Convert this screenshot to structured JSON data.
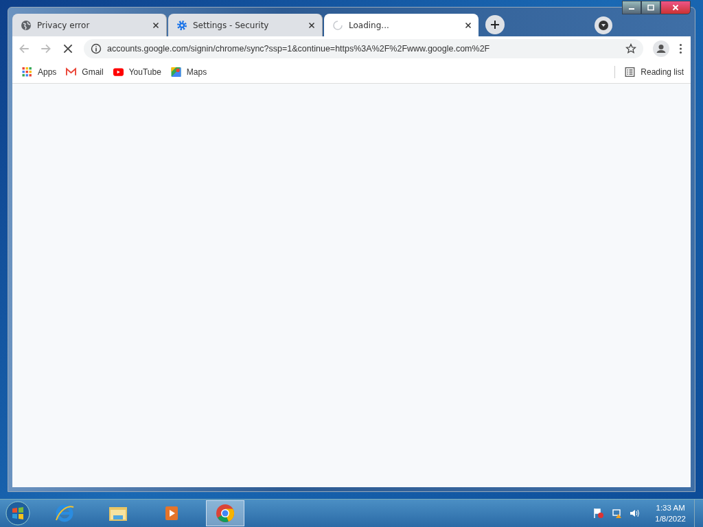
{
  "tabs": [
    {
      "kind": "globe",
      "title": "Privacy error",
      "selected": false
    },
    {
      "kind": "gear",
      "title": "Settings - Security",
      "selected": false
    },
    {
      "kind": "spinner",
      "title": "Loading...",
      "selected": true
    }
  ],
  "address": {
    "value": "accounts.google.com/signin/chrome/sync?ssp=1&continue=https%3A%2F%2Fwww.google.com%2F"
  },
  "bookmarks": [
    {
      "kind": "apps",
      "label": "Apps"
    },
    {
      "kind": "gmail",
      "label": "Gmail"
    },
    {
      "kind": "youtube",
      "label": "YouTube"
    },
    {
      "kind": "maps",
      "label": "Maps"
    }
  ],
  "reading_list": {
    "label": "Reading list"
  },
  "taskbar": {
    "items": [
      {
        "kind": "ie",
        "selected": false
      },
      {
        "kind": "explorer",
        "selected": false
      },
      {
        "kind": "media",
        "selected": false
      },
      {
        "kind": "chrome",
        "selected": true
      }
    ],
    "clock": {
      "time": "1:33 AM",
      "date": "1/8/2022"
    }
  }
}
